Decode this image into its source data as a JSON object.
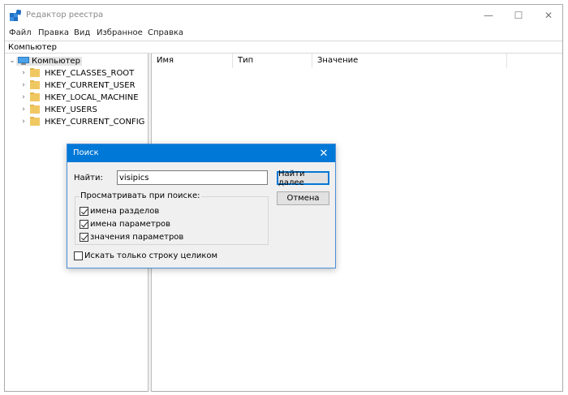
{
  "window": {
    "title": "Редактор реестра",
    "minimize": "—",
    "maximize": "☐",
    "close": "✕"
  },
  "menu": {
    "items": [
      "Файл",
      "Правка",
      "Вид",
      "Избранное",
      "Справка"
    ]
  },
  "address": "Компьютер",
  "tree": {
    "root": "Компьютер",
    "keys": [
      "HKEY_CLASSES_ROOT",
      "HKEY_CURRENT_USER",
      "HKEY_LOCAL_MACHINE",
      "HKEY_USERS",
      "HKEY_CURRENT_CONFIG"
    ]
  },
  "columns": [
    "Имя",
    "Тип",
    "Значение"
  ],
  "dialog": {
    "title": "Поиск",
    "close": "✕",
    "find_label": "Найти:",
    "find_value": "visipics",
    "find_next": "Найти далее",
    "cancel": "Отмена",
    "group_title": "Просматривать при поиске:",
    "options": [
      {
        "label": "имена разделов",
        "checked": true
      },
      {
        "label": "имена параметров",
        "checked": true
      },
      {
        "label": "значения параметров",
        "checked": true
      }
    ],
    "whole_string": {
      "label": "Искать только строку целиком",
      "checked": false
    }
  },
  "colors": {
    "accent": "#0078d7",
    "folder": "#f0c862"
  }
}
